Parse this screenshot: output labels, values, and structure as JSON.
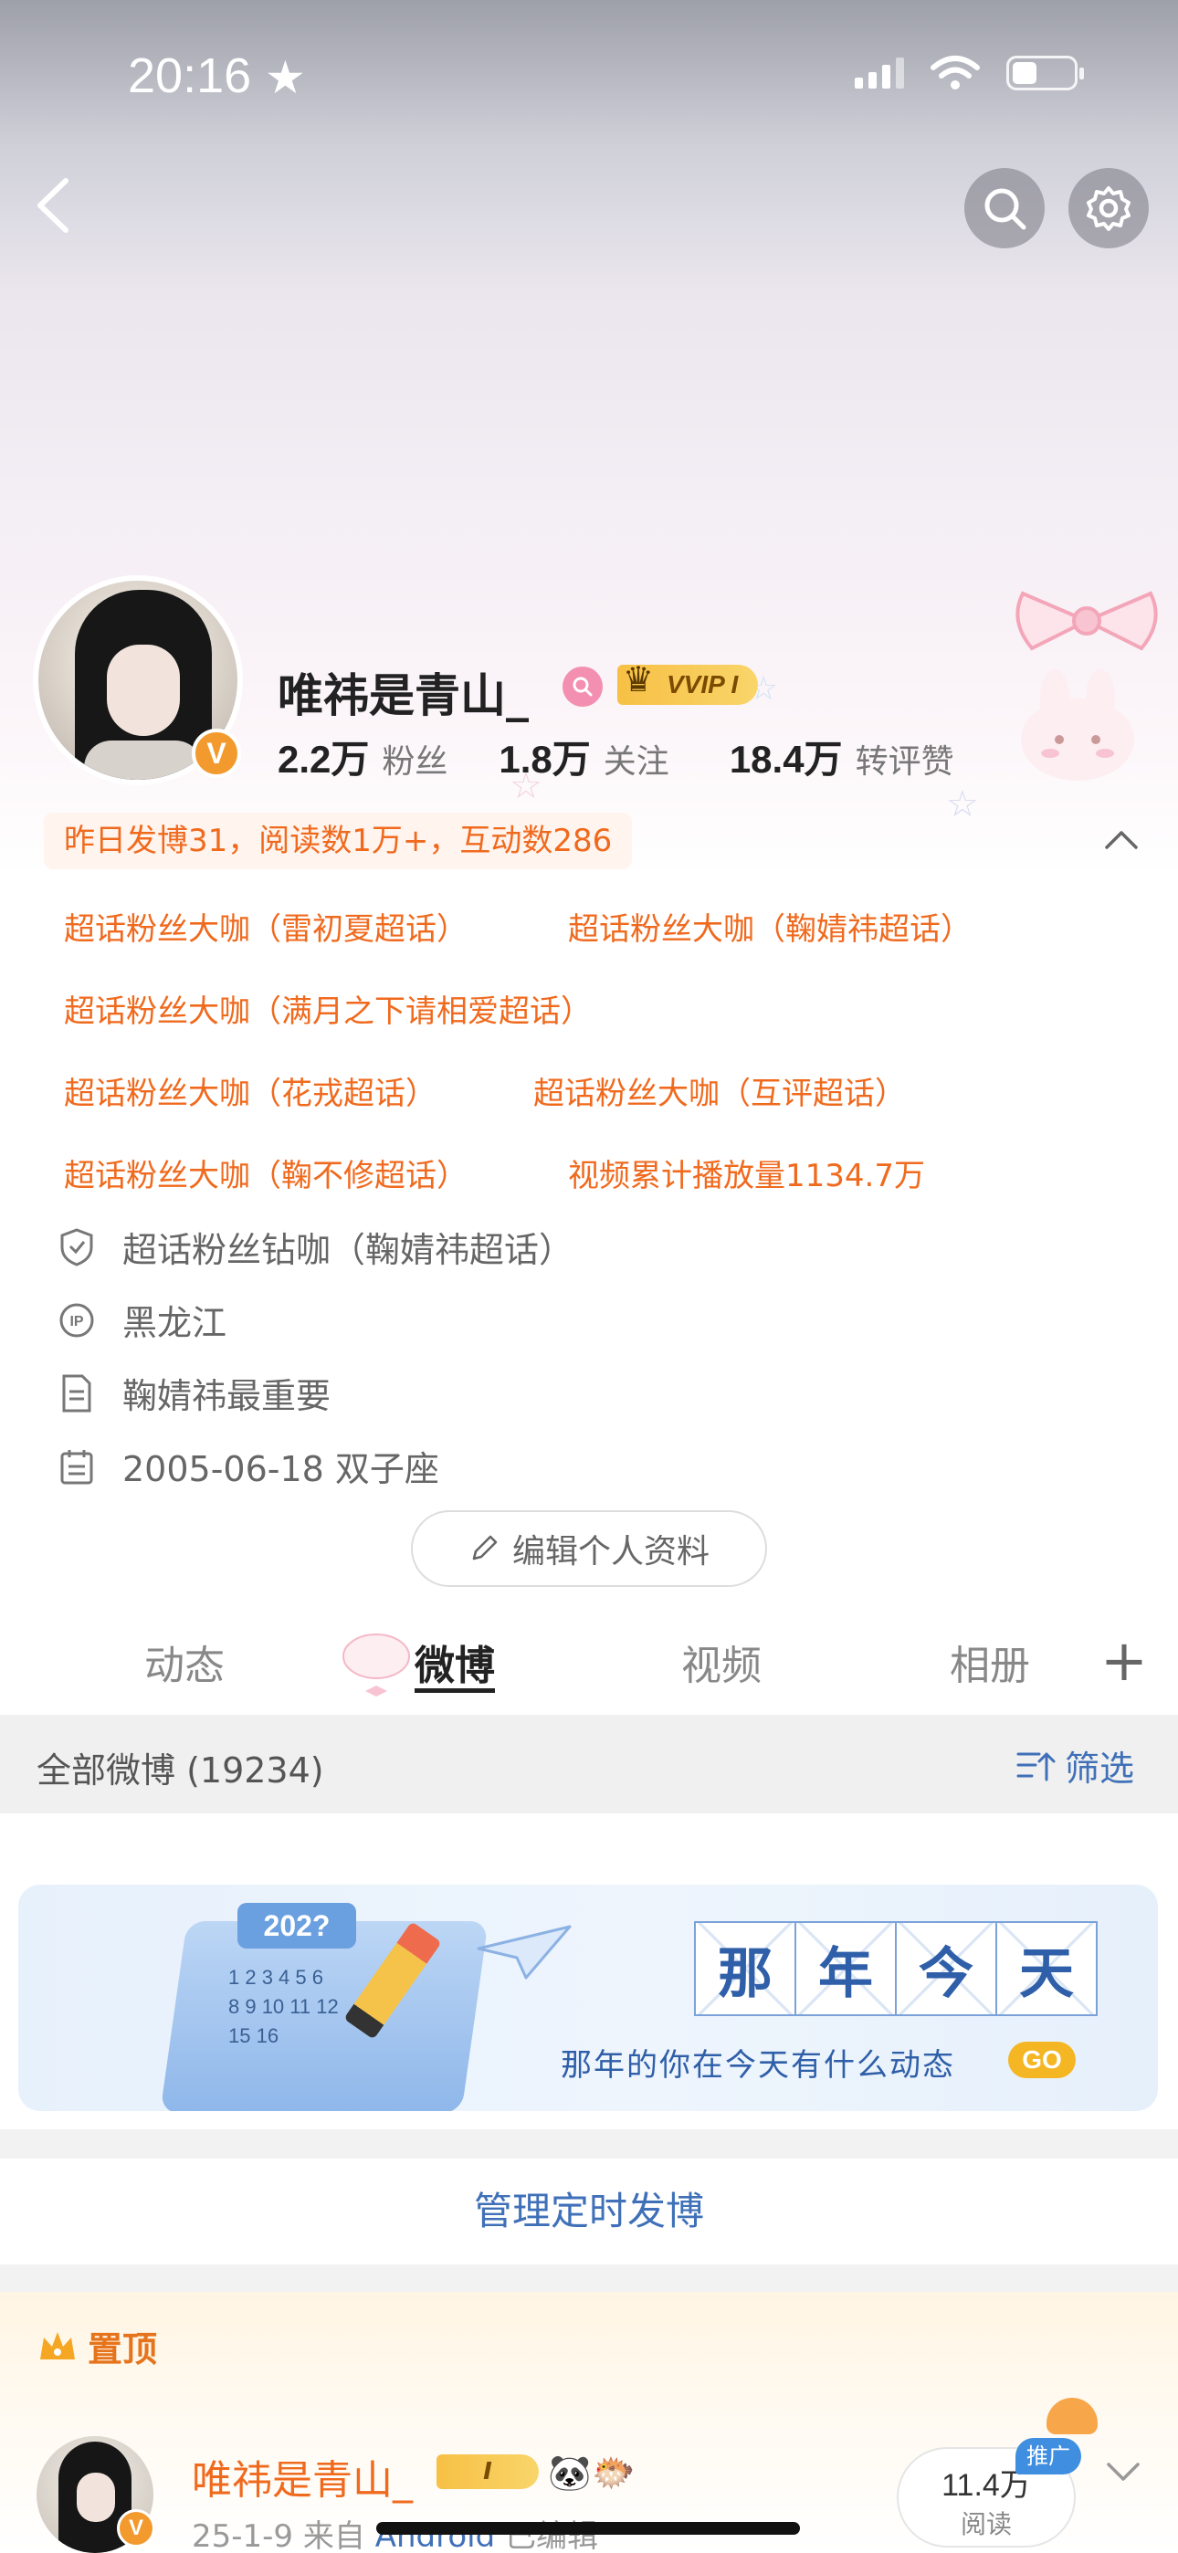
{
  "status": {
    "time": "20:16"
  },
  "profile": {
    "name": "唯祎是青山_",
    "vip_label": "VVIP I",
    "stats": [
      {
        "num": "2.2万",
        "label": "粉丝"
      },
      {
        "num": "1.8万",
        "label": "关注"
      },
      {
        "num": "18.4万",
        "label": "转评赞"
      }
    ],
    "summary": "昨日发博31，阅读数1万+，互动数286",
    "tags": [
      "超话粉丝大咖（雷初夏超话）",
      "超话粉丝大咖（鞠婧祎超话）",
      "超话粉丝大咖（满月之下请相爱超话）",
      "超话粉丝大咖（花戎超话）",
      "超话粉丝大咖（互评超话）",
      "超话粉丝大咖（鞠不修超话）",
      "视频累计播放量1134.7万"
    ],
    "info": [
      {
        "icon": "shield-icon",
        "text": "超话粉丝钻咖（鞠婧祎超话）"
      },
      {
        "icon": "ip-icon",
        "text": "黑龙江"
      },
      {
        "icon": "document-icon",
        "text": "鞠婧祎最重要"
      },
      {
        "icon": "calendar-icon",
        "text": "2005-06-18 双子座"
      }
    ],
    "edit_label": "编辑个人资料"
  },
  "tabs": [
    "动态",
    "微博",
    "视频",
    "相册"
  ],
  "active_tab": "微博",
  "feed": {
    "all_label": "全部微博 (19234)",
    "filter_label": "筛选"
  },
  "banner": {
    "year": "202?",
    "calendar_rows": [
      "1 2 3 4 5 6",
      "8 9 10 11 12",
      "15 16"
    ],
    "title_chars": [
      "那",
      "年",
      "今",
      "天"
    ],
    "subtitle": "那年的你在今天有什么动态",
    "go_label": "GO"
  },
  "manage_label": "管理定时发博",
  "pinned": {
    "label": "置顶",
    "author": "唯祎是青山_",
    "date": "25-1-9",
    "from_label": "来自",
    "source": "Android",
    "edited": "已编辑",
    "reads_num": "11.4万",
    "reads_label": "阅读",
    "promo": "推广",
    "vip_label": "I"
  },
  "colors": {
    "accent_orange": "#f06a1e",
    "link_blue": "#3f70b8",
    "vip_gold": "#f7c045"
  }
}
